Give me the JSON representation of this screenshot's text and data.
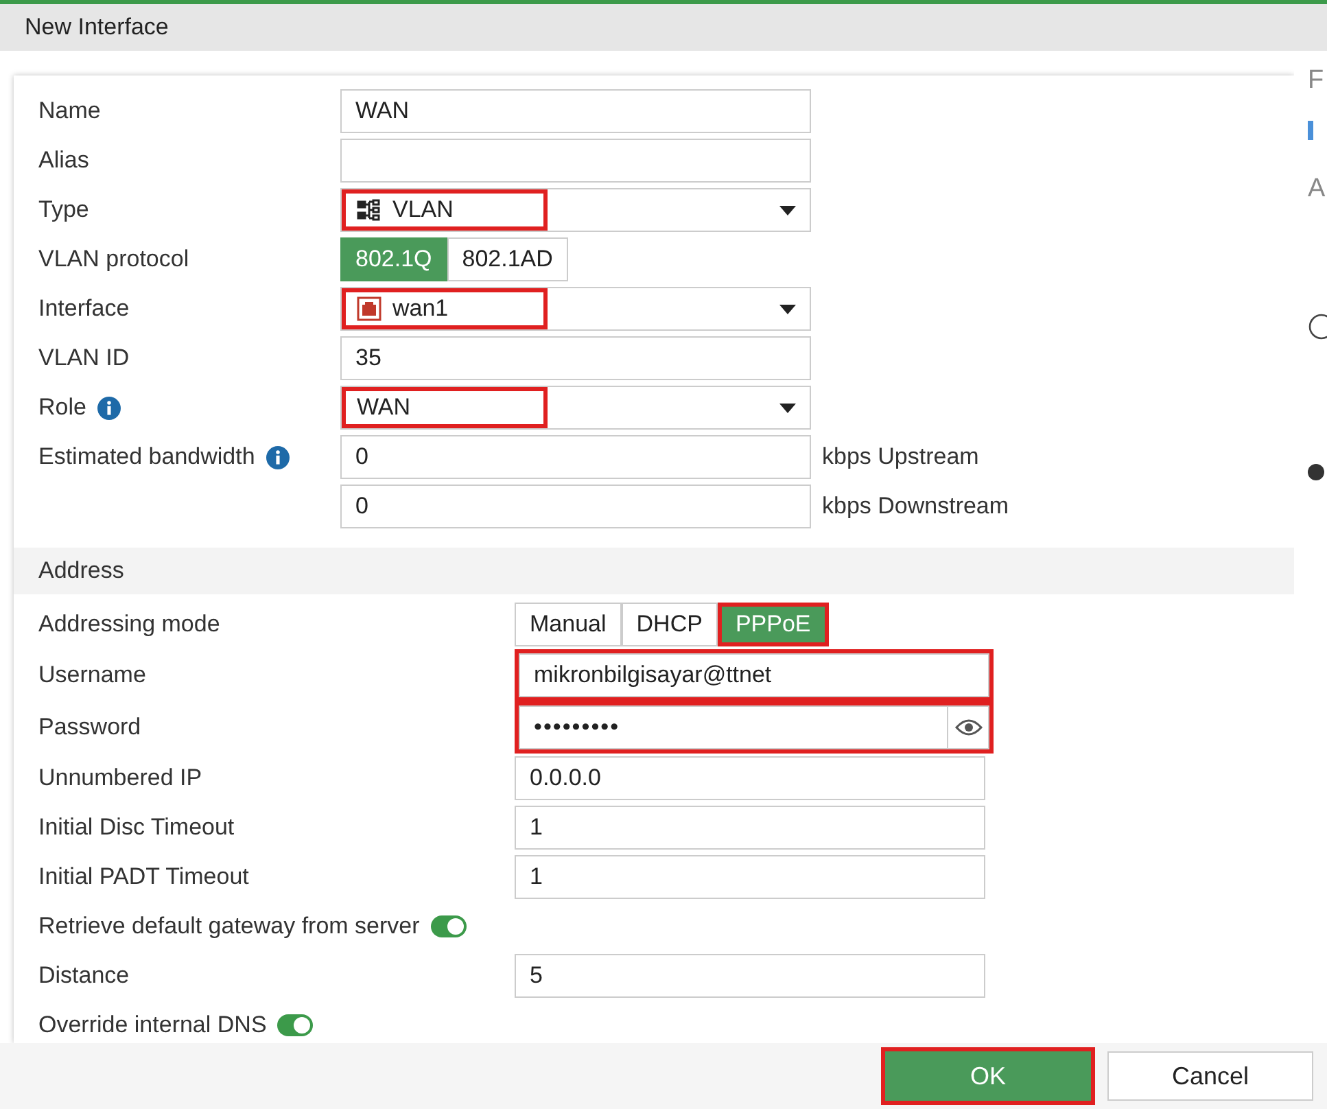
{
  "window": {
    "title": "New Interface"
  },
  "general": [
    {
      "kind": "text",
      "label": "Name",
      "value": "WAN",
      "highlighted": false
    },
    {
      "kind": "text",
      "label": "Alias",
      "highlighted": false
    },
    {
      "kind": "select",
      "label": "Type",
      "value": "VLAN",
      "highlighted": true
    },
    {
      "kind": "segmented",
      "label": "VLAN protocol",
      "options": [
        {
          "label": "802.1Q",
          "selected": true
        },
        {
          "label": "802.1AD",
          "selected": false
        }
      ],
      "highlighted": false
    },
    {
      "kind": "select",
      "label": "Interface",
      "value": "wan1",
      "highlighted": true
    },
    {
      "kind": "text",
      "label": "VLAN ID",
      "value": "35",
      "highlighted": false
    },
    {
      "kind": "select",
      "label": "Role",
      "value": "WAN",
      "info": true,
      "highlighted": true
    },
    {
      "kind": "text",
      "label": "Estimated bandwidth",
      "value": "0",
      "info": true,
      "suffix": "kbps Upstream",
      "highlighted": false
    },
    {
      "kind": "text",
      "value": "0",
      "suffix": "kbps Downstream",
      "highlighted": false
    }
  ],
  "address": {
    "title": "Address",
    "fields": [
      {
        "kind": "segmented",
        "label": "Addressing mode",
        "options": [
          {
            "label": "Manual",
            "selected": false
          },
          {
            "label": "DHCP",
            "selected": false
          },
          {
            "label": "PPPoE",
            "selected": true
          }
        ],
        "highlighted": true
      },
      {
        "kind": "text",
        "label": "Username",
        "value": "mikronbilgisayar@ttnet",
        "highlighted": true
      },
      {
        "kind": "password",
        "label": "Password",
        "value": "•••••••••",
        "highlighted": true
      },
      {
        "kind": "text",
        "label": "Unnumbered IP",
        "value": "0.0.0.0",
        "highlighted": false
      },
      {
        "kind": "text",
        "label": "Initial Disc Timeout",
        "value": "1",
        "highlighted": false
      },
      {
        "kind": "text",
        "label": "Initial PADT Timeout",
        "value": "1",
        "highlighted": false
      },
      {
        "kind": "toggle",
        "label": "Retrieve default gateway from server",
        "on": true,
        "highlighted": false
      },
      {
        "kind": "text",
        "label": "Distance",
        "value": "5",
        "highlighted": false
      },
      {
        "kind": "toggle",
        "label": "Override internal DNS",
        "on": true,
        "highlighted": false
      }
    ]
  },
  "side": {
    "heading_1": "F",
    "heading_2": "A"
  },
  "buttons": [
    {
      "label": "OK",
      "primary": true,
      "highlighted": true
    },
    {
      "label": "Cancel",
      "primary": false,
      "highlighted": false
    }
  ]
}
